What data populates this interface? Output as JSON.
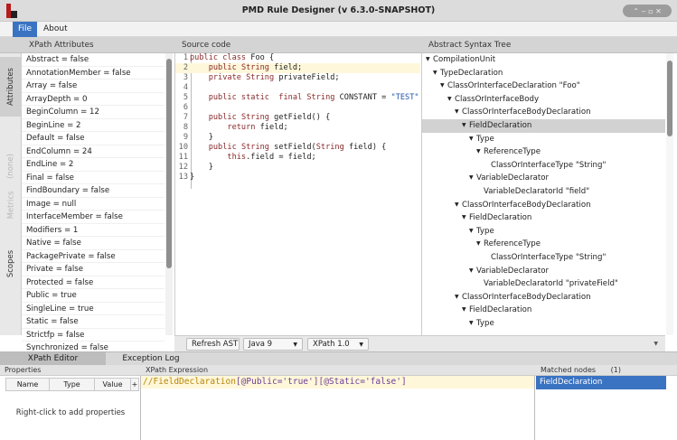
{
  "window": {
    "title": "PMD Rule Designer (v 6.3.0-SNAPSHOT)",
    "controls": "⌃ ‒ ▫ ✕"
  },
  "menu": {
    "file": "File",
    "about": "About"
  },
  "xpath_attributes": {
    "header": "XPath Attributes",
    "side_tabs": {
      "attributes": "Attributes",
      "none": "(none)",
      "metrics": "Metrics",
      "scopes": "Scopes"
    },
    "items": [
      "Abstract = false",
      "AnnotationMember = false",
      "Array = false",
      "ArrayDepth = 0",
      "BeginColumn = 12",
      "BeginLine = 2",
      "Default = false",
      "EndColumn = 24",
      "EndLine = 2",
      "Final = false",
      "FindBoundary = false",
      "Image = null",
      "InterfaceMember = false",
      "Modifiers = 1",
      "Native = false",
      "PackagePrivate = false",
      "Private = false",
      "Protected = false",
      "Public = true",
      "SingleLine = true",
      "Static = false",
      "Strictfp = false",
      "Synchronized = false"
    ]
  },
  "source": {
    "header": "Source code",
    "lines": [
      {
        "n": "1",
        "parts": [
          [
            "kw",
            "public class"
          ],
          [
            "t",
            " Foo {"
          ]
        ]
      },
      {
        "n": "2",
        "hl": true,
        "parts": [
          [
            "t",
            "    "
          ],
          [
            "kw",
            "public"
          ],
          [
            "t",
            " "
          ],
          [
            "ty",
            "String"
          ],
          [
            "t",
            " field;"
          ]
        ]
      },
      {
        "n": "3",
        "parts": [
          [
            "t",
            "    "
          ],
          [
            "kw",
            "private"
          ],
          [
            "t",
            " "
          ],
          [
            "ty",
            "String"
          ],
          [
            "t",
            " privateField;"
          ]
        ]
      },
      {
        "n": "4",
        "parts": [
          [
            "t",
            ""
          ]
        ]
      },
      {
        "n": "5",
        "parts": [
          [
            "t",
            "    "
          ],
          [
            "kw",
            "public static  final"
          ],
          [
            "t",
            " "
          ],
          [
            "ty",
            "String"
          ],
          [
            "t",
            " CONSTANT = "
          ],
          [
            "str",
            "\"TEST\""
          ],
          [
            "t",
            ";"
          ]
        ]
      },
      {
        "n": "6",
        "parts": [
          [
            "t",
            ""
          ]
        ]
      },
      {
        "n": "7",
        "parts": [
          [
            "t",
            "    "
          ],
          [
            "kw",
            "public"
          ],
          [
            "t",
            " "
          ],
          [
            "ty",
            "String"
          ],
          [
            "t",
            " getField() {"
          ]
        ]
      },
      {
        "n": "8",
        "parts": [
          [
            "t",
            "        "
          ],
          [
            "kw",
            "return"
          ],
          [
            "t",
            " field;"
          ]
        ]
      },
      {
        "n": "9",
        "parts": [
          [
            "t",
            "    }"
          ]
        ]
      },
      {
        "n": "10",
        "parts": [
          [
            "t",
            "    "
          ],
          [
            "kw",
            "public"
          ],
          [
            "t",
            " "
          ],
          [
            "ty",
            "String"
          ],
          [
            "t",
            " setField("
          ],
          [
            "ty",
            "String"
          ],
          [
            "t",
            " field) {"
          ]
        ]
      },
      {
        "n": "11",
        "parts": [
          [
            "t",
            "        "
          ],
          [
            "kw",
            "this"
          ],
          [
            "t",
            ".field = field;"
          ]
        ]
      },
      {
        "n": "12",
        "parts": [
          [
            "t",
            "    }"
          ]
        ]
      },
      {
        "n": "13",
        "parts": [
          [
            "t",
            "}"
          ]
        ]
      }
    ]
  },
  "ast": {
    "header": "Abstract Syntax Tree",
    "nodes": [
      {
        "label": "CompilationUnit",
        "depth": 0,
        "toggle": true
      },
      {
        "label": "TypeDeclaration",
        "depth": 1,
        "toggle": true
      },
      {
        "label": "ClassOrInterfaceDeclaration \"Foo\"",
        "depth": 2,
        "toggle": true
      },
      {
        "label": "ClassOrInterfaceBody",
        "depth": 3,
        "toggle": true
      },
      {
        "label": "ClassOrInterfaceBodyDeclaration",
        "depth": 4,
        "toggle": true
      },
      {
        "label": "FieldDeclaration",
        "depth": 5,
        "toggle": true,
        "selected": true
      },
      {
        "label": "Type",
        "depth": 6,
        "toggle": true
      },
      {
        "label": "ReferenceType",
        "depth": 7,
        "toggle": true
      },
      {
        "label": "ClassOrInterfaceType \"String\"",
        "depth": 8,
        "toggle": false
      },
      {
        "label": "VariableDeclarator",
        "depth": 6,
        "toggle": true
      },
      {
        "label": "VariableDeclaratorId \"field\"",
        "depth": 7,
        "toggle": false
      },
      {
        "label": "ClassOrInterfaceBodyDeclaration",
        "depth": 4,
        "toggle": true
      },
      {
        "label": "FieldDeclaration",
        "depth": 5,
        "toggle": true
      },
      {
        "label": "Type",
        "depth": 6,
        "toggle": true
      },
      {
        "label": "ReferenceType",
        "depth": 7,
        "toggle": true
      },
      {
        "label": "ClassOrInterfaceType \"String\"",
        "depth": 8,
        "toggle": false
      },
      {
        "label": "VariableDeclarator",
        "depth": 6,
        "toggle": true
      },
      {
        "label": "VariableDeclaratorId \"privateField\"",
        "depth": 7,
        "toggle": false
      },
      {
        "label": "ClassOrInterfaceBodyDeclaration",
        "depth": 4,
        "toggle": true
      },
      {
        "label": "FieldDeclaration",
        "depth": 5,
        "toggle": true
      },
      {
        "label": "Type",
        "depth": 6,
        "toggle": true
      }
    ]
  },
  "toolbar": {
    "refresh_label": "Refresh AST",
    "language": "Java 9",
    "xpath_version": "XPath 1.0"
  },
  "bottom_tabs": {
    "editor": "XPath Editor",
    "log": "Exception Log"
  },
  "properties": {
    "header": "Properties",
    "columns": [
      "Name",
      "Type",
      "Value"
    ],
    "add": "+",
    "hint": "Right-click to add properties"
  },
  "xpath": {
    "header": "XPath Expression",
    "prefix": "//FieldDeclaration",
    "pred1": "[@Public='true']",
    "pred2": "[@Static='false']"
  },
  "matched": {
    "header": "Matched nodes",
    "count": "(1)",
    "items": [
      "FieldDeclaration"
    ]
  },
  "colors": {
    "accent": "#3a73c2",
    "highlight_line": "#fff7d9",
    "keyword": "#8a2a2a",
    "string": "#2255aa"
  }
}
